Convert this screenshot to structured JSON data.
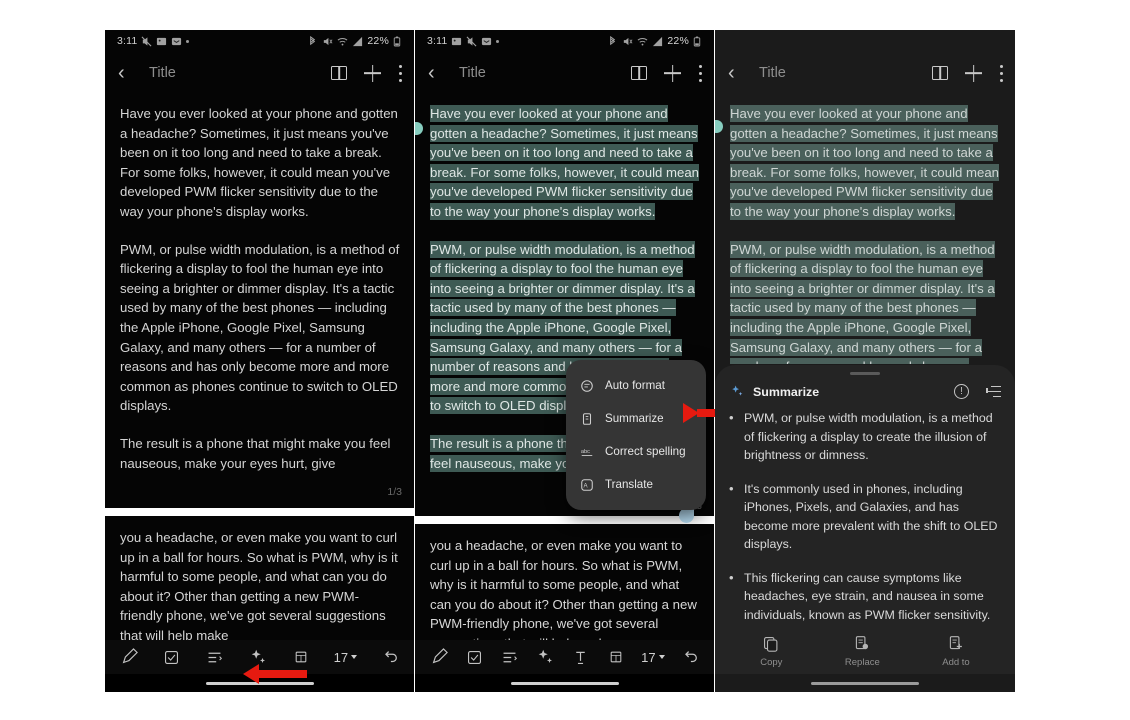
{
  "status_bar": {
    "time": "3:11",
    "battery": "22%",
    "left_icons": [
      "mute-icon",
      "image-icon",
      "messages-icon",
      "dot-icon"
    ],
    "right_icons": [
      "bluetooth-icon",
      "volume-off-icon",
      "wifi-icon",
      "signal-icon"
    ]
  },
  "header": {
    "back": "‹",
    "title": "Title",
    "icons": [
      "book-icon",
      "plus-icon",
      "kebab-menu-icon"
    ]
  },
  "note": {
    "paragraphs": [
      "Have you ever looked at your phone and gotten a headache? Sometimes, it just means you've been on it too long and need to take a break. For some folks, however, it could mean you've developed PWM flicker sensitivity due to the way your phone's display works.",
      "PWM, or pulse width modulation, is a method of flickering a display to fool the human eye into seeing a brighter or dimmer display. It's a tactic used by many of the best phones — including the Apple iPhone, Google Pixel, Samsung Galaxy, and many others — for a number of reasons and has only become more and more common as phones continue to switch to OLED displays.",
      "The result is a phone that might make you feel nauseous, make your eyes hurt, give"
    ],
    "page_counter": "1/3",
    "continuation": "you a headache, or even make you want to curl up in a ball for hours. So what is PWM, why is it harmful to some people, and what can you do about it? Other than getting a new PWM-friendly phone, we've got several suggestions that will help make"
  },
  "toolbar": {
    "font_size": "17",
    "icons": [
      "pen-icon",
      "checkbox-icon",
      "list-format-icon",
      "ai-sparkle-icon",
      "text-style-icon",
      "table-icon",
      "undo-icon"
    ]
  },
  "popup_menu": {
    "items": [
      {
        "label": "Auto format",
        "icon": "auto-format-icon"
      },
      {
        "label": "Summarize",
        "icon": "summarize-icon"
      },
      {
        "label": "Correct spelling",
        "icon": "spellcheck-icon"
      },
      {
        "label": "Translate",
        "icon": "translate-icon"
      }
    ]
  },
  "summarize_sheet": {
    "title": "Summarize",
    "title_icon": "ai-sparkle-icon",
    "header_icons": [
      "info-icon",
      "detail-level-icon"
    ],
    "bullets": [
      "PWM, or pulse width modulation, is a method of flickering a display to create the illusion of brightness or dimness.",
      "It's commonly used in phones, including iPhones, Pixels, and Galaxies, and has become more prevalent with the shift to OLED displays.",
      "This flickering can cause symptoms like headaches, eye strain, and nausea in some individuals, known as PWM flicker sensitivity."
    ],
    "actions": [
      {
        "label": "Copy",
        "icon": "copy-icon"
      },
      {
        "label": "Replace",
        "icon": "replace-icon"
      },
      {
        "label": "Add to",
        "icon": "add-to-icon"
      }
    ]
  },
  "colors": {
    "selection_highlight": "#3e5a54",
    "handle_start": "#86cdbf",
    "handle_end": "#b9dff5",
    "arrow": "#e61a10",
    "sheet_bg": "#242424",
    "popup_bg": "#353535"
  }
}
